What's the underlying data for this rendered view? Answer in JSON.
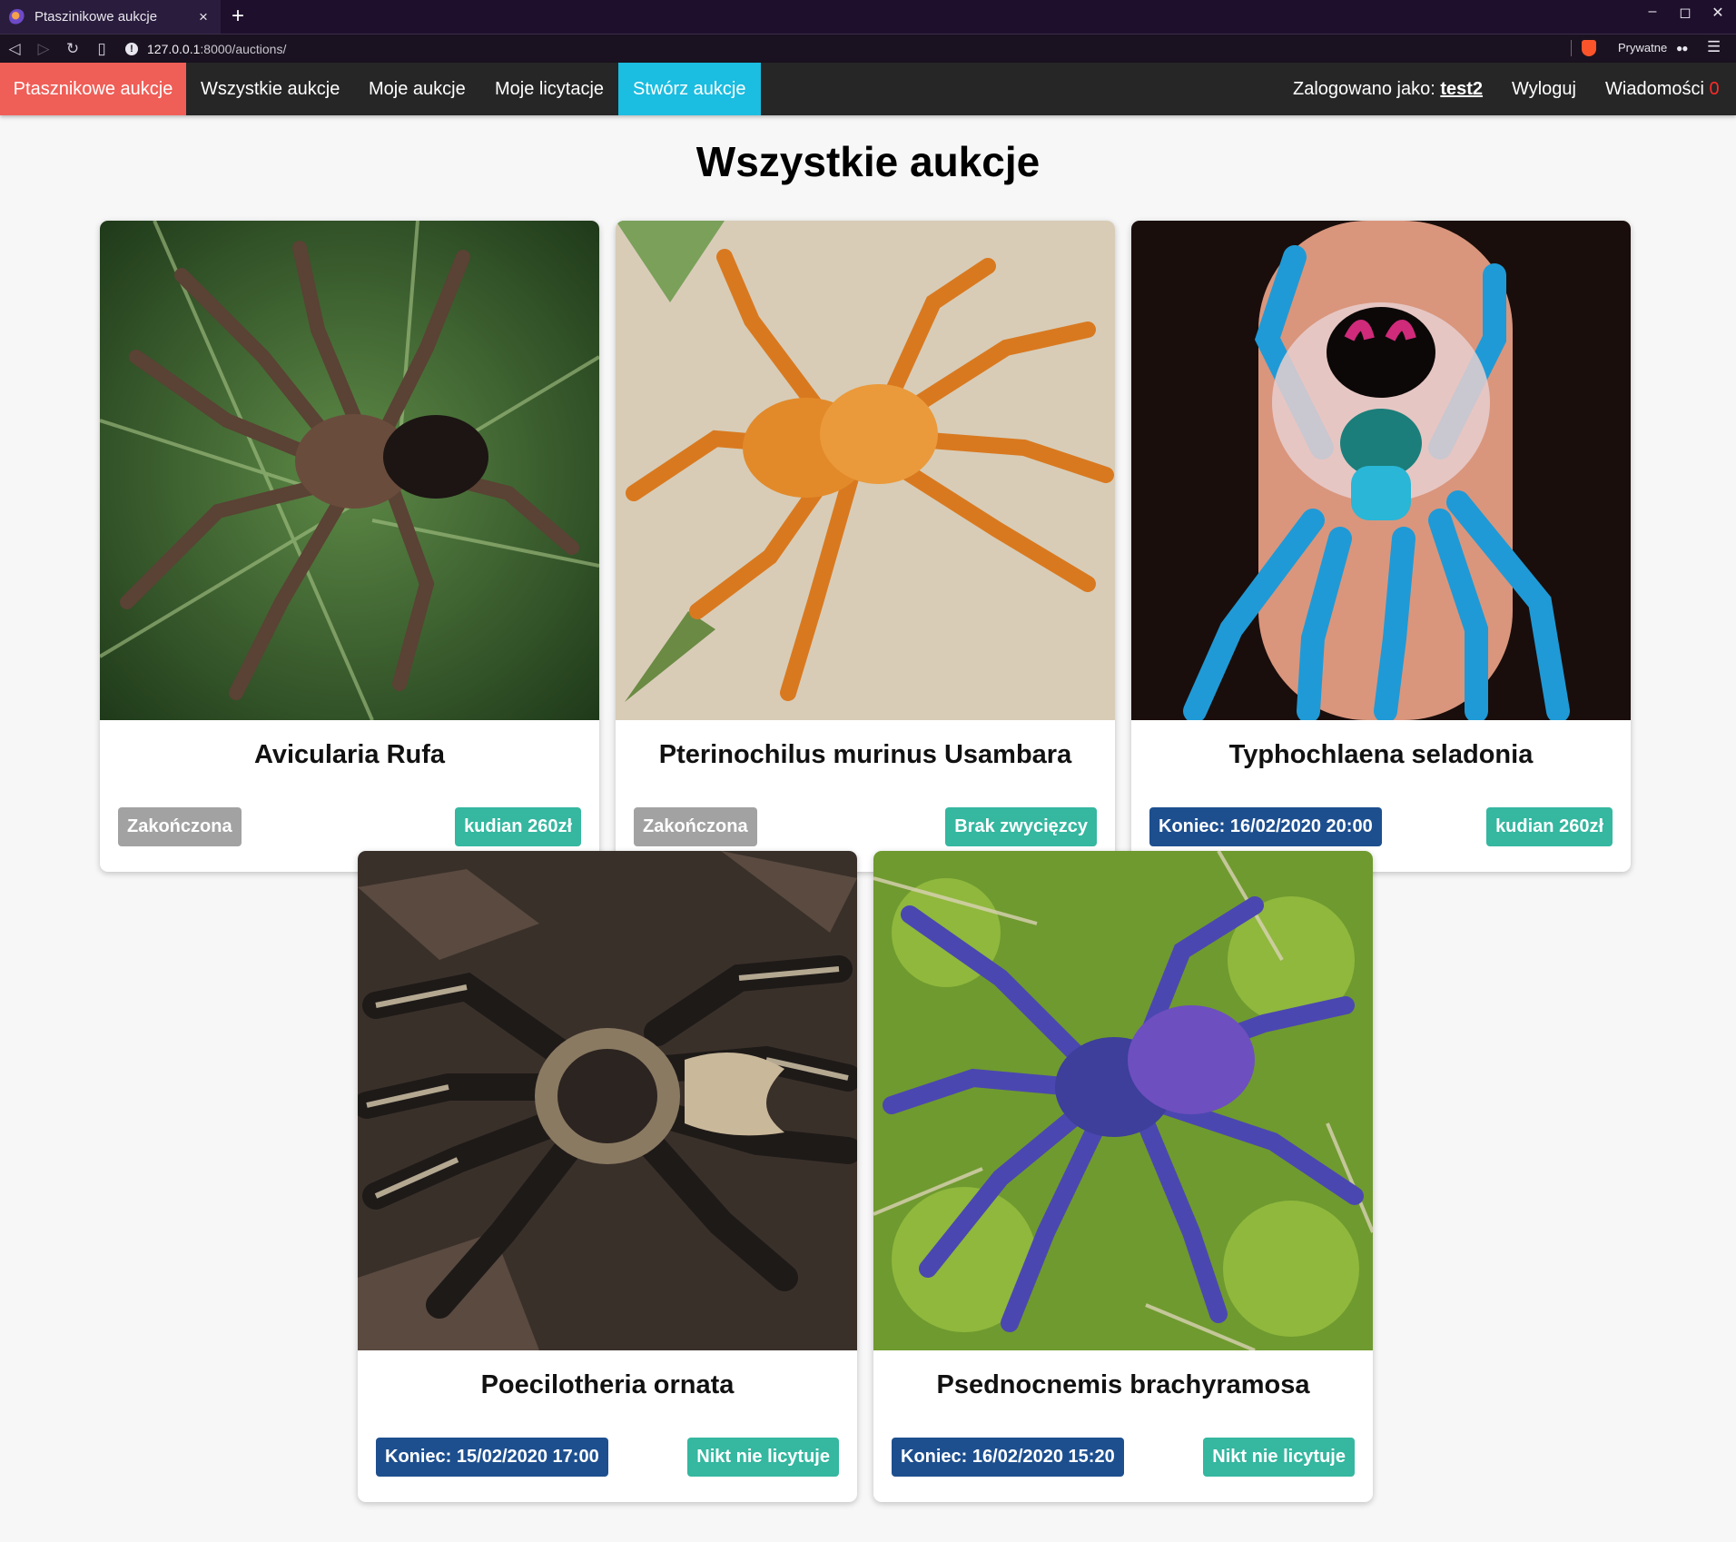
{
  "browser": {
    "tab_title": "Ptaszinikowe aukcje",
    "tab_close": "×",
    "new_tab": "+",
    "url_host": "127.0.0.1",
    "url_rest": ":8000/auctions/",
    "private_label": "Prywatne"
  },
  "navbar": {
    "brand": "Ptasznikowe aukcje",
    "all_auctions": "Wszystkie aukcje",
    "my_auctions": "Moje aukcje",
    "my_bids": "Moje licytacje",
    "create_auction": "Stwórz aukcje",
    "logged_in_label": "Zalogowano jako:",
    "username": "test2",
    "logout": "Wyloguj",
    "messages_label": "Wiadomości",
    "messages_count": "0"
  },
  "page": {
    "title": "Wszystkie aukcje"
  },
  "auctions": [
    {
      "name": "Avicularia Rufa",
      "status": "Zakończona",
      "status_color": "#a2a2a2",
      "result": "kudian 260zł",
      "image": "brown tarantula on green leaf"
    },
    {
      "name": "Pterinochilus murinus Usambara",
      "status": "Zakończona",
      "status_color": "#a2a2a2",
      "result": "Brak zwycięzcy",
      "image": "orange tarantula on sand"
    },
    {
      "name": "Typhochlaena seladonia",
      "status": "Koniec: 16/02/2020 20:00",
      "status_color": "#1d4f8f",
      "result": "kudian 260zł",
      "image": "blue-legged spider on finger"
    },
    {
      "name": "Poecilotheria ornata",
      "status": "Koniec: 15/02/2020 17:00",
      "status_color": "#1d4f8f",
      "result": "Nikt nie licytuje",
      "image": "patterned tarantula on bark"
    },
    {
      "name": "Psednocnemis brachyramosa",
      "status": "Koniec: 16/02/2020 15:20",
      "status_color": "#1d4f8f",
      "result": "Nikt nie licytuje",
      "image": "blue tarantula on moss"
    }
  ],
  "colors": {
    "brand": "#ef5e57",
    "create": "#1bbde0",
    "navbar_bg": "#262626",
    "badge_grey": "#a2a2a2",
    "badge_blue": "#1d4f8f",
    "badge_teal": "#35b7a0"
  }
}
